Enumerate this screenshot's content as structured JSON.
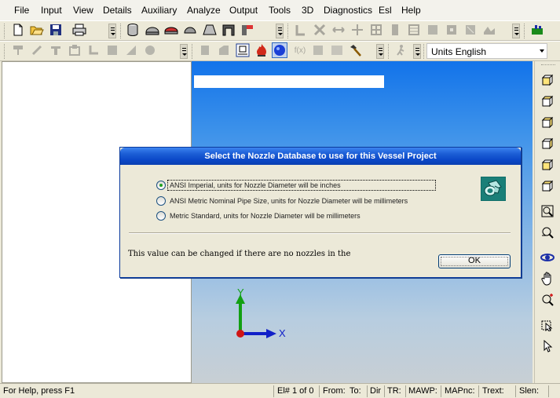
{
  "menubar": {
    "items": [
      {
        "label": "File"
      },
      {
        "label": "Input"
      },
      {
        "label": "View"
      },
      {
        "label": "Details"
      },
      {
        "label": "Auxiliary"
      },
      {
        "label": "Analyze"
      },
      {
        "label": "Output"
      },
      {
        "label": "Tools"
      },
      {
        "label": "3D"
      },
      {
        "label": "Diagnostics"
      },
      {
        "label": "Esl"
      },
      {
        "label": "Help"
      }
    ]
  },
  "toolbar": {
    "units_label": "Units",
    "units_value": "English"
  },
  "dialog": {
    "title": "Select the Nozzle Database to use for this Vessel Project",
    "options": [
      {
        "label": "ANSI Imperial, units for Nozzle Diameter will be inches",
        "checked": true
      },
      {
        "label": "ANSI Metric Nominal Pipe Size, units for Nozzle Diameter will be millimeters",
        "checked": false
      },
      {
        "label": "Metric Standard, units for Nozzle Diameter will be millimeters",
        "checked": false
      }
    ],
    "message": "This value can be changed if there are no nozzles in the",
    "ok_label": "OK"
  },
  "viewport": {
    "axis_x_label": "X",
    "axis_y_label": "Y"
  },
  "statusbar": {
    "help_text": "For Help, press F1",
    "element": "El# 1 of 0",
    "from": "From:",
    "to": "To:",
    "dir": "Dir",
    "tr": "TR:",
    "mawp": "MAWP:",
    "mapnc": "MAPnc:",
    "trext": "Trext:",
    "slen": "Slen:"
  },
  "colors": {
    "title_bar": "#0b48c8",
    "viewport_top": "#1273ea",
    "viewport_bottom": "#c8cfd4"
  }
}
